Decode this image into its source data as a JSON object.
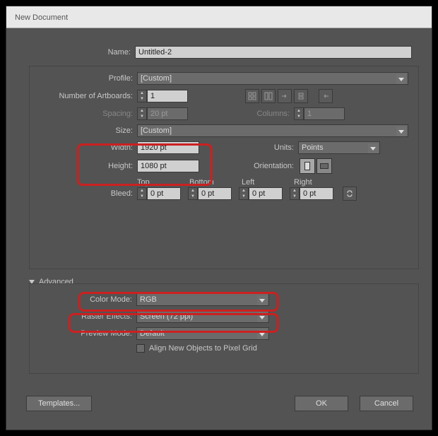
{
  "window": {
    "title": "New Document"
  },
  "labels": {
    "name": "Name:",
    "profile": "Profile:",
    "numArtboards": "Number of Artboards:",
    "spacing": "Spacing:",
    "columns": "Columns:",
    "size": "Size:",
    "width": "Width:",
    "height": "Height:",
    "units": "Units:",
    "orientation": "Orientation:",
    "bleed": "Bleed:",
    "top": "Top",
    "bottom": "Bottom",
    "left": "Left",
    "right": "Right",
    "advanced": "Advanced",
    "colorMode": "Color Mode:",
    "rasterEffects": "Raster Effects:",
    "previewMode": "Preview Mode:",
    "alignPixel": "Align New Objects to Pixel Grid"
  },
  "values": {
    "name": "Untitled-2",
    "profile": "[Custom]",
    "artboards": "1",
    "spacing": "20 pt",
    "columns": "1",
    "size": "[Custom]",
    "width": "1920 pt",
    "height": "1080 pt",
    "units": "Points",
    "bleedTop": "0 pt",
    "bleedBottom": "0 pt",
    "bleedLeft": "0 pt",
    "bleedRight": "0 pt",
    "colorMode": "RGB",
    "rasterEffects": "Screen (72 ppi)",
    "previewMode": "Default"
  },
  "buttons": {
    "templates": "Templates...",
    "ok": "OK",
    "cancel": "Cancel"
  }
}
